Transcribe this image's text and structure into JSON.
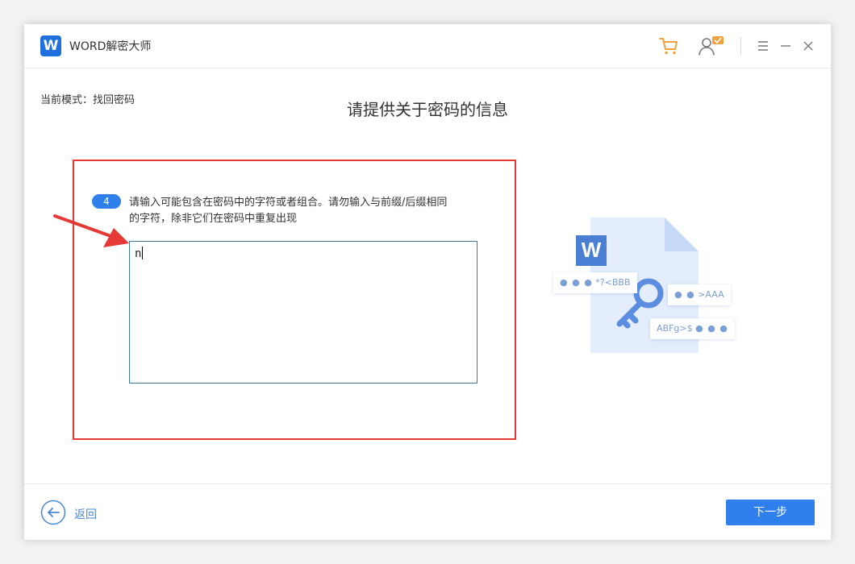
{
  "app": {
    "logo_letter": "W",
    "title": "WORD解密大师"
  },
  "titlebar": {
    "icons": [
      "cart-icon",
      "user-icon",
      "menu-icon",
      "minimize-icon",
      "close-icon"
    ],
    "accent": "#f0a03c"
  },
  "mode_label": "当前模式：找回密码",
  "page_title": "请提供关于密码的信息",
  "step": {
    "number": "4",
    "hint_line1": "请输入可能包含在密码中的字符或者组合。请勿输入与前缀/后缀相同",
    "hint_line2": "的字符，除非它们在密码中重复出现",
    "input_value": "n"
  },
  "illustration": {
    "doc_letter": "W",
    "chip1_dots": "● ● ●",
    "chip1_text": "*?<BBB",
    "chip2_dots": "● ●",
    "chip2_text": ">AAA",
    "chip3_text": "ABFg>$",
    "chip3_dots": "● ● ●"
  },
  "footer": {
    "back_label": "返回",
    "next_label": "下一步"
  },
  "colors": {
    "primary": "#2f80ed",
    "highlight_box": "#e53935",
    "annotation_arrow": "#e53935"
  }
}
